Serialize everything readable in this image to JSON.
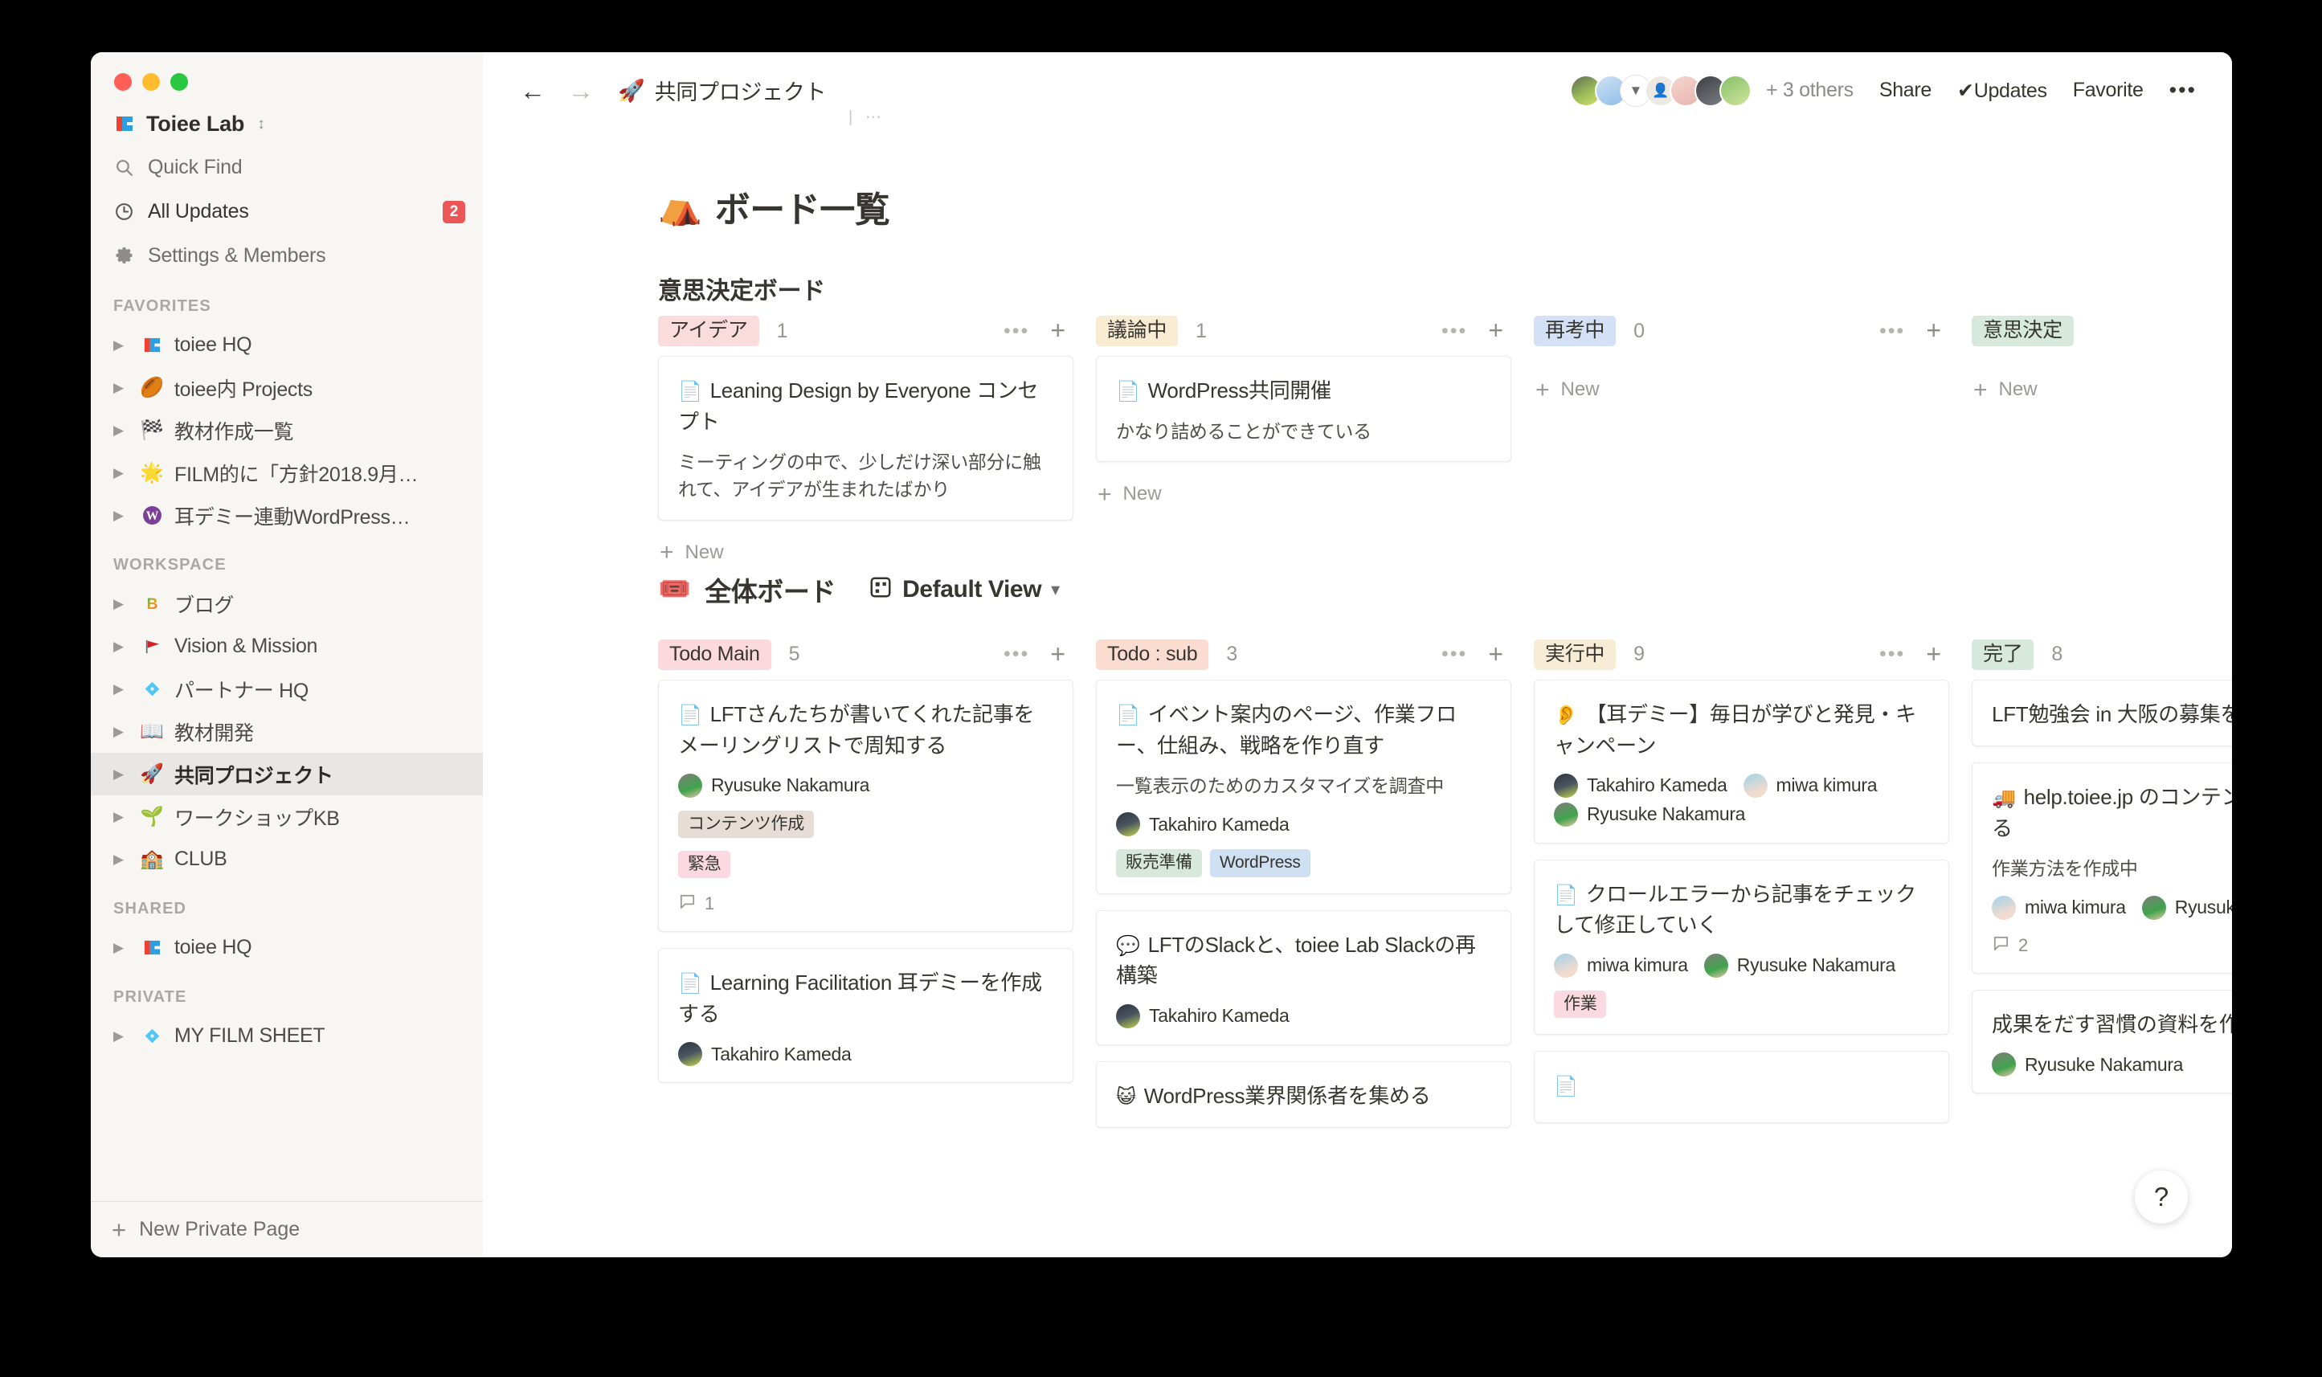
{
  "window": {
    "traffic_lights": [
      "close",
      "minimize",
      "zoom"
    ]
  },
  "sidebar": {
    "workspace_name": "Toiee Lab",
    "workspace_icon": "toiee-logo",
    "nav": [
      {
        "label": "Quick Find",
        "icon": "search-icon",
        "badge": ""
      },
      {
        "label": "All Updates",
        "icon": "clock-icon",
        "badge": "2"
      },
      {
        "label": "Settings & Members",
        "icon": "gear-icon",
        "badge": ""
      }
    ],
    "sections": [
      {
        "title": "FAVORITES",
        "items": [
          {
            "emoji": "",
            "label": "toiee HQ",
            "icon_name": "toiee-logo"
          },
          {
            "emoji": "🏉",
            "label": "toiee内 Projects",
            "icon_name": "rugby-ball"
          },
          {
            "emoji": "🏁",
            "label": "教材作成一覧",
            "icon_name": "checkered-flag"
          },
          {
            "emoji": "🌟",
            "label": "FILM的に「方針2018.9月…",
            "icon_name": "glowing-star"
          },
          {
            "emoji": "Ⓦ",
            "label": "耳デミー連動WordPress…",
            "icon_name": "wordpress-logo"
          }
        ]
      },
      {
        "title": "WORKSPACE",
        "items": [
          {
            "emoji": "🅱️",
            "label": "ブログ",
            "icon_name": "b-button"
          },
          {
            "emoji": "🚩",
            "label": "Vision & Mission",
            "icon_name": "triangular-flag"
          },
          {
            "emoji": "💠",
            "label": "パートナー HQ",
            "icon_name": "diamond-with-dot"
          },
          {
            "emoji": "📖",
            "label": "教材開発",
            "icon_name": "open-book"
          },
          {
            "emoji": "🚀",
            "label": "共同プロジェクト",
            "icon_name": "rocket",
            "active": true
          },
          {
            "emoji": "🌱",
            "label": "ワークショップKB",
            "icon_name": "seedling"
          },
          {
            "emoji": "🏫",
            "label": "CLUB",
            "icon_name": "school"
          }
        ]
      },
      {
        "title": "SHARED",
        "items": [
          {
            "emoji": "",
            "label": "toiee HQ",
            "icon_name": "toiee-logo"
          }
        ]
      },
      {
        "title": "PRIVATE",
        "items": [
          {
            "emoji": "💠",
            "label": "MY FILM SHEET",
            "icon_name": "diamond-with-dot"
          }
        ]
      }
    ],
    "footer": {
      "label": "New Private Page",
      "icon": "plus-icon"
    }
  },
  "topbar": {
    "back_icon": "arrow-left-icon",
    "forward_icon": "arrow-right-icon",
    "breadcrumb_emoji": "🚀",
    "breadcrumb_title": "共同プロジェクト",
    "others_label": "+ 3 others",
    "share_label": "Share",
    "updates_label": "Updates",
    "updates_check": "✔",
    "favorite_label": "Favorite",
    "more_icon": "ellipsis-icon",
    "avatars": [
      "photo",
      "blue",
      "white",
      "mono",
      "pink",
      "dark",
      "green"
    ]
  },
  "page": {
    "emoji": "⛺",
    "title": "ボード一覧"
  },
  "boards": [
    {
      "name": "意思決定ボード",
      "emoji": "",
      "view": "",
      "new_label": "New",
      "columns": [
        {
          "tag": "アイデア",
          "tag_bg": "#fbdcdc",
          "count": "1",
          "cards": [
            {
              "icon": "📄",
              "title": "Leaning Design by Everyone コンセプト",
              "subtitle": "ミーティングの中で、少しだけ深い部分に触れて、アイデアが生まれたばかり",
              "people": [],
              "tags": [],
              "comments": ""
            }
          ]
        },
        {
          "tag": "議論中",
          "tag_bg": "#faecd2",
          "count": "1",
          "cards": [
            {
              "icon": "📄",
              "title": "WordPress共同開催",
              "subtitle": "かなり詰めることができている",
              "people": [],
              "tags": [],
              "comments": ""
            }
          ]
        },
        {
          "tag": "再考中",
          "tag_bg": "#d3e0f5",
          "count": "0",
          "cards": []
        },
        {
          "tag": "意思決定",
          "tag_bg": "#d7e8dd",
          "count": "",
          "cards": []
        }
      ]
    },
    {
      "name": "全体ボード",
      "emoji": "🎟️",
      "view": "Default View",
      "view_icon": "board-view-icon",
      "new_label": "New",
      "columns": [
        {
          "tag": "Todo Main",
          "tag_bg": "#fbd9de",
          "count": "5",
          "cards": [
            {
              "icon": "📄",
              "title": "LFTさんたちが書いてくれた記事をメーリングリストで周知する",
              "subtitle": "",
              "people": [
                {
                  "name": "Ryusuke Nakamura",
                  "avatar": "ryu"
                }
              ],
              "tags": [
                {
                  "label": "コンテンツ作成",
                  "bg": "#e8ddd6"
                },
                {
                  "label": "緊急",
                  "bg": "#fbd9e0"
                }
              ],
              "comments": "1"
            },
            {
              "icon": "📄",
              "title": "Learning Facilitation 耳デミーを作成する",
              "subtitle": "",
              "people": [
                {
                  "name": "Takahiro Kameda",
                  "avatar": "kameda"
                }
              ],
              "tags": [],
              "comments": ""
            }
          ]
        },
        {
          "tag": "Todo : sub",
          "tag_bg": "#fadcd1",
          "count": "3",
          "cards": [
            {
              "icon": "📄",
              "title": "イベント案内のページ、作業フロー、仕組み、戦略を作り直す",
              "subtitle": "一覧表示のためのカスタマイズを調査中",
              "people": [
                {
                  "name": "Takahiro Kameda",
                  "avatar": "kameda"
                }
              ],
              "tags": [
                {
                  "label": "販売準備",
                  "bg": "#d9e8dd"
                },
                {
                  "label": "WordPress",
                  "bg": "#cfe0f2"
                }
              ],
              "comments": ""
            },
            {
              "icon": "💬",
              "title": "LFTのSlackと、toiee Lab Slackの再構築",
              "subtitle": "",
              "people": [
                {
                  "name": "Takahiro Kameda",
                  "avatar": "kameda"
                }
              ],
              "tags": [],
              "comments": ""
            },
            {
              "icon": "😺",
              "title": "WordPress業界関係者を集める",
              "subtitle": "",
              "people": [],
              "tags": [],
              "comments": ""
            }
          ]
        },
        {
          "tag": "実行中",
          "tag_bg": "#f7ecd6",
          "count": "9",
          "cards": [
            {
              "icon": "👂",
              "title": "【耳デミー】毎日が学びと発見・キャンペーン",
              "subtitle": "",
              "people": [
                {
                  "name": "Takahiro Kameda",
                  "avatar": "kameda"
                },
                {
                  "name": "miwa kimura",
                  "avatar": "miwa"
                },
                {
                  "name": "Ryusuke Nakamura",
                  "avatar": "ryu"
                }
              ],
              "tags": [],
              "comments": ""
            },
            {
              "icon": "📄",
              "title": "クロールエラーから記事をチェックして修正していく",
              "subtitle": "",
              "people": [
                {
                  "name": "miwa kimura",
                  "avatar": "miwa"
                },
                {
                  "name": "Ryusuke Nakamura",
                  "avatar": "ryu"
                }
              ],
              "tags": [
                {
                  "label": "作業",
                  "bg": "#fbd9e0"
                }
              ],
              "comments": ""
            },
            {
              "icon": "📄",
              "title": "",
              "subtitle": "",
              "people": [],
              "tags": [],
              "comments": ""
            }
          ]
        },
        {
          "tag": "完了",
          "tag_bg": "#d7e8dd",
          "count": "8",
          "cards": [
            {
              "icon": "",
              "title": "LFT勉強会 in 大阪の募集をする",
              "subtitle": "",
              "people": [],
              "tags": [],
              "comments": ""
            },
            {
              "icon": "🚚",
              "title": "help.toiee.jp のコンテンツを移動させる",
              "subtitle": "作業方法を作成中",
              "people": [
                {
                  "name": "miwa kimura",
                  "avatar": "miwa"
                },
                {
                  "name": "Ryusuke N",
                  "avatar": "ryu"
                }
              ],
              "tags": [],
              "comments": "2"
            },
            {
              "icon": "",
              "title": "成果をだす習慣の資料を作成す",
              "subtitle": "",
              "people": [
                {
                  "name": "Ryusuke Nakamura",
                  "avatar": "ryu"
                }
              ],
              "tags": [],
              "comments": ""
            }
          ]
        }
      ]
    }
  ],
  "help": {
    "label": "?",
    "icon": "question-mark-icon"
  }
}
